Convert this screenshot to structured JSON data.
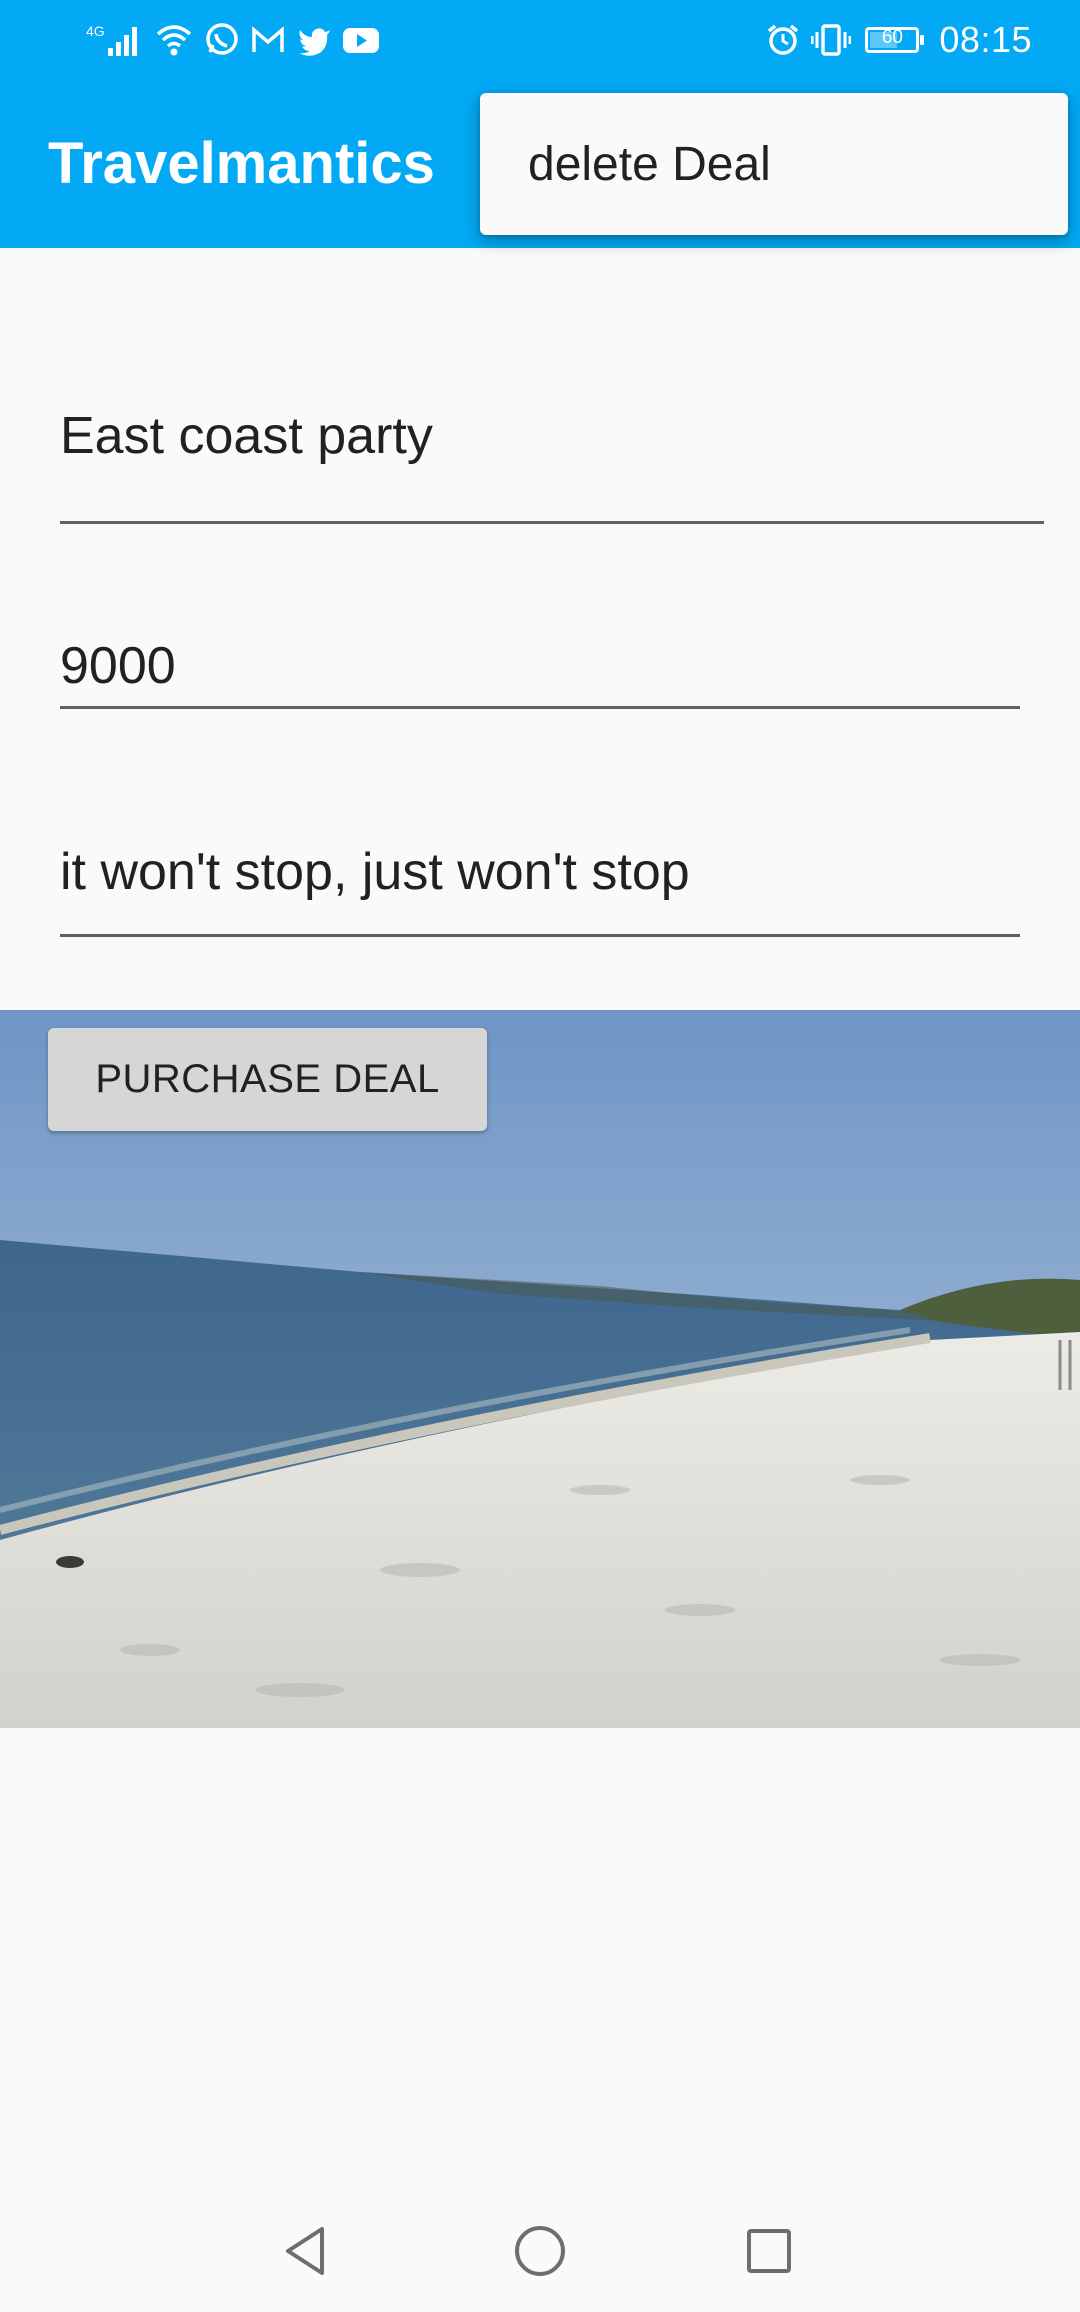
{
  "status_bar": {
    "network_label": "4G",
    "battery_level": "60",
    "battery_fraction": 0.6,
    "time": "08:15",
    "icons": [
      "signal-icon",
      "wifi-icon",
      "whatsapp-icon",
      "gmail-icon",
      "twitter-icon",
      "youtube-icon",
      "alarm-icon",
      "vibrate-icon",
      "battery-icon"
    ]
  },
  "app_bar": {
    "title": "Travelmantics"
  },
  "overflow_menu": {
    "items": [
      {
        "label": "delete Deal"
      }
    ]
  },
  "form": {
    "title_value": "East coast party",
    "price_value": "9000",
    "description_value": "it won't stop, just won't stop"
  },
  "actions": {
    "purchase_label": "PURCHASE DEAL"
  },
  "image": {
    "subject": "beach-photo"
  },
  "nav_bar": {
    "icons": [
      "back-icon",
      "home-icon",
      "recents-icon"
    ]
  },
  "colors": {
    "primary": "#03a9f4",
    "background": "#fafafa",
    "text": "#212121",
    "button": "#d6d6d6"
  }
}
